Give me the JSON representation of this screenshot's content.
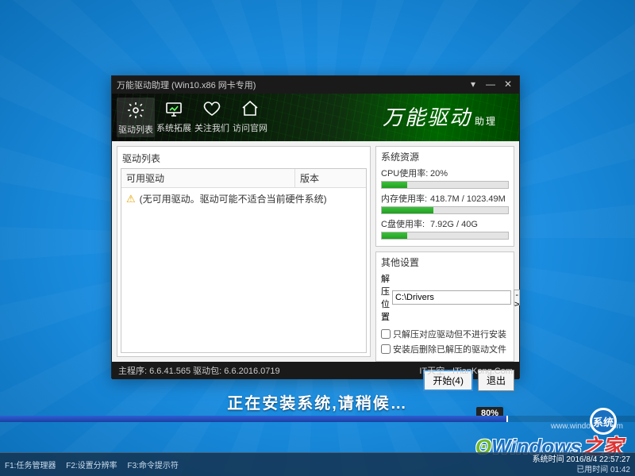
{
  "window": {
    "title": "万能驱动助理 (Win10.x86 网卡专用)"
  },
  "nav": {
    "items": [
      {
        "label": "驱动列表"
      },
      {
        "label": "系统拓展"
      },
      {
        "label": "关注我们"
      },
      {
        "label": "访问官网"
      }
    ]
  },
  "brand": {
    "main": "万能驱动",
    "sub": "助理"
  },
  "left": {
    "title": "驱动列表",
    "col_name": "可用驱动",
    "col_ver": "版本",
    "row_msg": "(无可用驱动。驱动可能不适合当前硬件系统)"
  },
  "resources": {
    "title": "系统资源",
    "cpu_label": "CPU使用率:",
    "cpu_value": "20%",
    "cpu_pct": 20,
    "mem_label": "内存使用率:",
    "mem_value": "418.7M / 1023.49M",
    "mem_pct": 41,
    "disk_label": "C盘使用率:",
    "disk_value": "7.92G / 40G",
    "disk_pct": 20
  },
  "other": {
    "title": "其他设置",
    "path_label": "解压位置",
    "path_value": "C:\\Drivers",
    "browse_label": "->",
    "chk1": "只解压对应驱动但不进行安装",
    "chk2": "安装后删除已解压的驱动文件"
  },
  "buttons": {
    "start": "开始(4)",
    "exit": "退出"
  },
  "footer": {
    "left": "主程序: 6.6.41.565   驱动包: 6.6.2016.0719",
    "right": "IT天空 - ITianKong.Com"
  },
  "install": {
    "text": "正在安装系统,请稍候…",
    "badge": "80%",
    "pct": 80
  },
  "watermark": {
    "url": "www.windowszj.com",
    "badge": "系统",
    "logo_win": "Windows",
    "logo_zh": "之家"
  },
  "taskbar": {
    "f1": "F1:任务管理器",
    "f2": "F2:设置分辨率",
    "f3": "F3:命令提示符",
    "sys_time": "系统时间 2016/8/4 22:57:27",
    "run_time": "已用时间 01:42"
  },
  "chart_data": {
    "type": "bar",
    "title": "系统资源",
    "series": [
      {
        "name": "CPU使用率",
        "value_label": "20%",
        "value": 20,
        "max": 100
      },
      {
        "name": "内存使用率",
        "value_label": "418.7M / 1023.49M",
        "value": 418.7,
        "max": 1023.49
      },
      {
        "name": "C盘使用率",
        "value_label": "7.92G / 40G",
        "value": 7.92,
        "max": 40
      }
    ]
  }
}
